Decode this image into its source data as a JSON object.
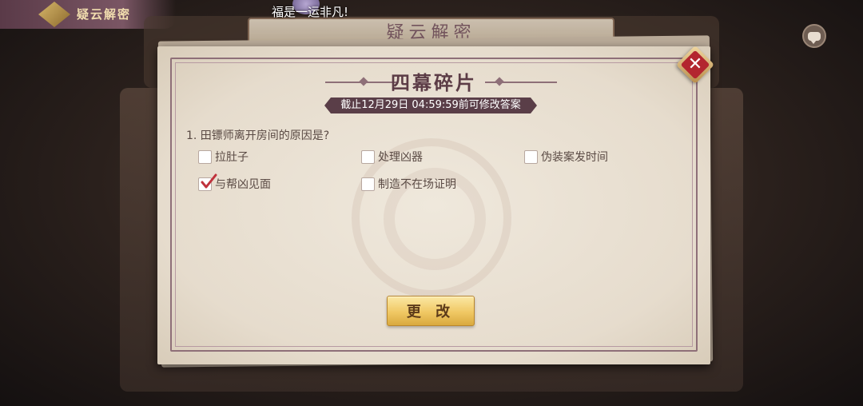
{
  "hud": {
    "banner_title": "疑云解密",
    "background_title": "疑云解密",
    "marquee_text": "福是一运非凡!"
  },
  "dialog": {
    "title": "四幕碎片",
    "deadline": "截止12月29日 04:59:59前可修改答案",
    "question": "1. 田镖师离开房间的原因是?",
    "options": [
      {
        "label": "拉肚子",
        "checked": false
      },
      {
        "label": "处理凶器",
        "checked": false
      },
      {
        "label": "伪装案发时间",
        "checked": false
      },
      {
        "label": "与帮凶见面",
        "checked": true
      },
      {
        "label": "制造不在场证明",
        "checked": false
      }
    ],
    "change_button": "更 改",
    "close_icon": "close-x-icon"
  },
  "colors": {
    "title": "#5c3c46",
    "deadline_bg": "#5a3e48",
    "button_gold": "#f0c864",
    "close_red": "#b3262f",
    "check_red": "#c0323c"
  }
}
